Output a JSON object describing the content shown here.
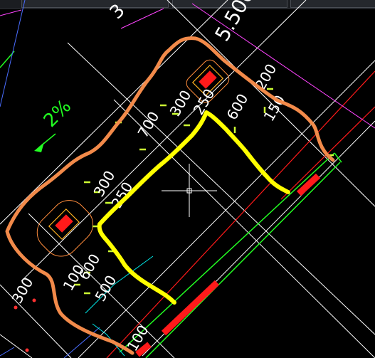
{
  "colors": {
    "background": "#000000",
    "cad_white": "#ffffff",
    "cad_red": "#ff1a1a",
    "cad_green": "#22ff22",
    "cad_magenta": "#ff44ff",
    "cad_cyan": "#00e5e5",
    "cad_blue": "#4a6dff",
    "dim_tick": "#ccff33",
    "markup_orange": "#f28a4a",
    "markup_yellow": "#ffff00"
  },
  "cursor": {
    "type": "crosshair"
  },
  "drawing_text": {
    "top_elevation": "5.500",
    "top_fragment": "3",
    "slope": "2%",
    "dim_700": "700",
    "dim_300_upper": "300",
    "dim_250_upper": "250",
    "dim_600_upper": "600",
    "dim_200_upper": "200",
    "dim_150_upper": "150",
    "dim_300_left": "300",
    "dim_250_left": "250",
    "dim_100": "100",
    "dim_600_left": "600",
    "dim_500": "500",
    "dim_300_bottom": "300",
    "dim_100_bottom": "100"
  }
}
